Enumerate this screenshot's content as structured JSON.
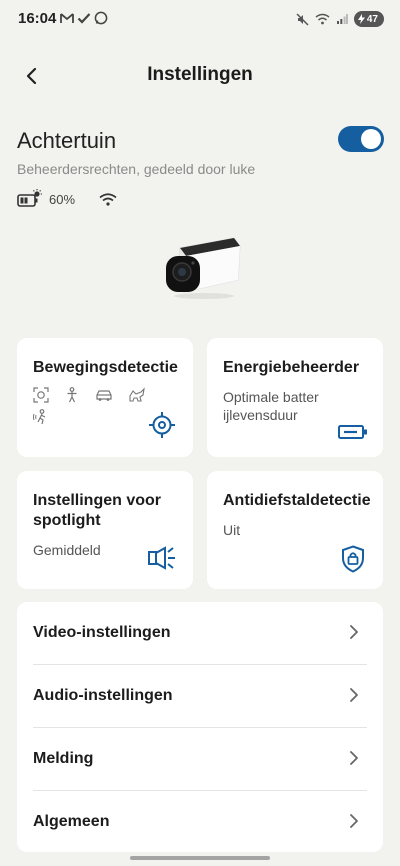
{
  "status_bar": {
    "time": "16:04",
    "battery": "47",
    "left_icons": [
      "gmail-icon",
      "check-icon",
      "whatsapp-icon"
    ],
    "right_icons": [
      "mute-icon",
      "wifi-icon",
      "signal-icon",
      "battery-charging-icon"
    ]
  },
  "header": {
    "title": "Instellingen",
    "back_icon": "chevron-left-icon"
  },
  "device": {
    "name": "Achtertuin",
    "enabled": true,
    "subtitle": "Beheerdersrechten, gedeeld door luke",
    "battery": "60%",
    "battery_icon": "battery-solar-icon",
    "wifi_icon": "wifi-icon"
  },
  "cards": {
    "motion": {
      "title": "Bewegingsdetectie",
      "icons": [
        "face-detect-icon",
        "person-icon",
        "vehicle-icon",
        "pet-icon",
        "motion-person-icon"
      ],
      "action_icon": "crosshair-icon"
    },
    "energy": {
      "title": "Energiebeheerder",
      "desc_line1": "Optimale batter",
      "desc_line2": "ijlevensduur",
      "icon": "battery-icon"
    },
    "spotlight": {
      "title_line1": "Instellingen voor",
      "title_line2": "spotlight",
      "desc": "Gemiddeld",
      "icon": "spotlight-icon"
    },
    "antitheft": {
      "title": "Antidiefstaldetectie",
      "desc": "Uit",
      "icon": "shield-lock-icon"
    }
  },
  "list": [
    {
      "label": "Video-instellingen"
    },
    {
      "label": "Audio-instellingen"
    },
    {
      "label": "Melding"
    },
    {
      "label": "Algemeen"
    }
  ],
  "colors": {
    "accent": "#155fa0",
    "background": "#f2f2ee",
    "card": "#ffffff"
  }
}
